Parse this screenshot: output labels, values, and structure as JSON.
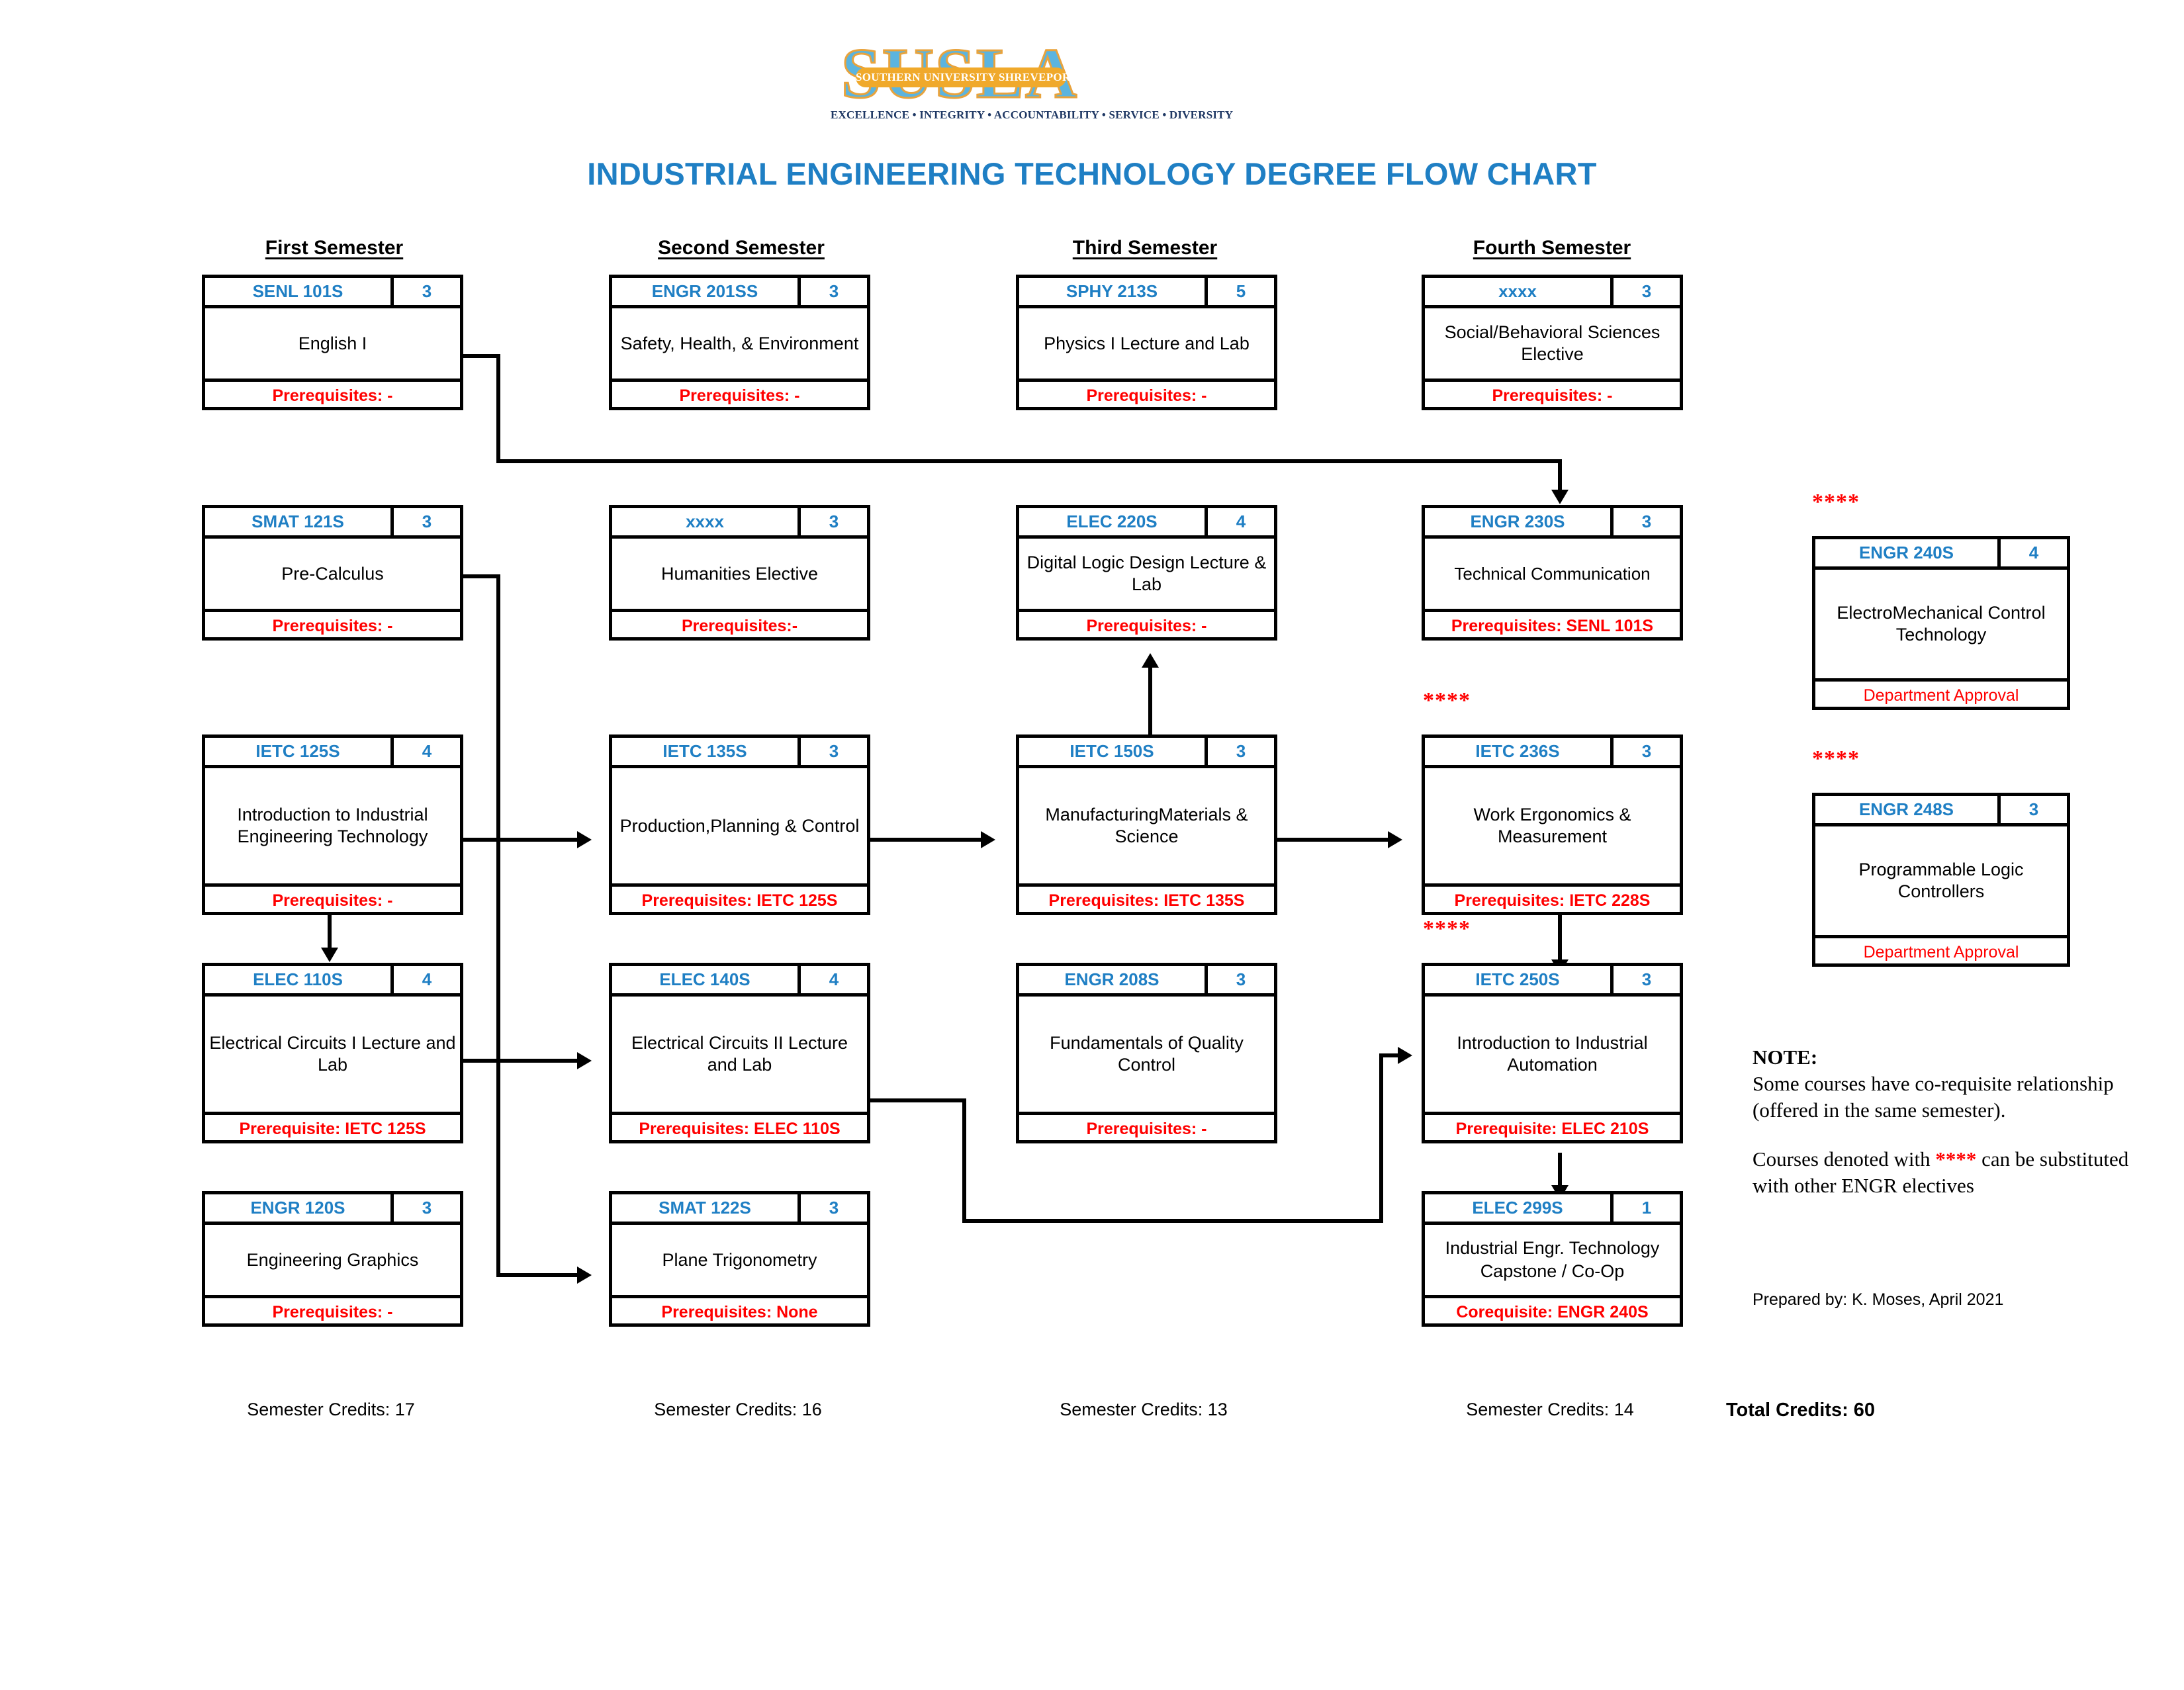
{
  "logo": {
    "word": "SUSLA",
    "band": "SOUTHERN UNIVERSITY SHREVEPORT LOUISIANA",
    "tagline": "EXCELLENCE  •  INTEGRITY  •  ACCOUNTABILITY  •  SERVICE  •  DIVERSITY"
  },
  "title": "INDUSTRIAL ENGINEERING TECHNOLOGY DEGREE FLOW CHART",
  "colors": {
    "title_blue": "#1F7FC4",
    "code_blue": "#1F7FC4",
    "prereq_red": "#FF0000",
    "logo_blue": "#5BB4DF",
    "logo_gold": "#F0A92B"
  },
  "semesters": [
    {
      "header": "First Semester",
      "credits_label": "Semester Credits: 17"
    },
    {
      "header": "Second Semester",
      "credits_label": "Semester Credits: 16"
    },
    {
      "header": "Third Semester",
      "credits_label": "Semester Credits: 13"
    },
    {
      "header": "Fourth Semester",
      "credits_label": "Semester Credits: 14"
    }
  ],
  "total_credits_label": "Total Credits: 60",
  "courses": {
    "senl101s": {
      "code": "SENL 101S",
      "credits": "3",
      "title": "English I",
      "prereq": "Prerequisites: -"
    },
    "smat121s": {
      "code": "SMAT 121S",
      "credits": "3",
      "title": "Pre-Calculus",
      "prereq": "Prerequisites: -"
    },
    "ietc125s": {
      "code": "IETC 125S",
      "credits": "4",
      "title": "Introduction to Industrial Engineering Technology",
      "prereq": "Prerequisites: -"
    },
    "elec110s": {
      "code": "ELEC 110S",
      "credits": "4",
      "title": "Electrical Circuits I Lecture and Lab",
      "prereq": "Prerequisite: IETC 125S"
    },
    "engr120s": {
      "code": "ENGR 120S",
      "credits": "3",
      "title": "Engineering Graphics",
      "prereq": "Prerequisites: -"
    },
    "engr201ss": {
      "code": "ENGR 201SS",
      "credits": "3",
      "title": "Safety, Health, & Environment",
      "prereq": "Prerequisites: -"
    },
    "hum": {
      "code": "xxxx",
      "credits": "3",
      "title": "Humanities Elective",
      "prereq": "Prerequisites:-"
    },
    "ietc135s": {
      "code": "IETC 135S",
      "credits": "3",
      "title": "Production,Planning & Control",
      "prereq": "Prerequisites: IETC 125S"
    },
    "elec140s": {
      "code": "ELEC 140S",
      "credits": "4",
      "title": "Electrical Circuits II Lecture and Lab",
      "prereq": "Prerequisites: ELEC 110S"
    },
    "smat122s": {
      "code": "SMAT 122S",
      "credits": "3",
      "title": "Plane Trigonometry",
      "prereq": "Prerequisites: None"
    },
    "sphy213s": {
      "code": "SPHY 213S",
      "credits": "5",
      "title": "Physics I Lecture and Lab",
      "prereq": "Prerequisites: -"
    },
    "elec220s": {
      "code": "ELEC 220S",
      "credits": "4",
      "title": "Digital Logic Design Lecture & Lab",
      "prereq": "Prerequisites: -"
    },
    "ietc150s": {
      "code": "IETC 150S",
      "credits": "3",
      "title": "ManufacturingMaterials & Science",
      "prereq": "Prerequisites: IETC 135S"
    },
    "engr208s": {
      "code": "ENGR 208S",
      "credits": "3",
      "title": "Fundamentals of Quality Control",
      "prereq": "Prerequisites: -"
    },
    "soc": {
      "code": "xxxx",
      "credits": "3",
      "title": "Social/Behavioral Sciences Elective",
      "prereq": "Prerequisites: -"
    },
    "engr230s": {
      "code": "ENGR 230S",
      "credits": "3",
      "title": "Technical Communication",
      "prereq": "Prerequisites: SENL 101S"
    },
    "ietc236s": {
      "code": "IETC 236S",
      "credits": "3",
      "title": "Work Ergonomics & Measurement",
      "prereq": "Prerequisites: IETC 228S"
    },
    "ietc250s": {
      "code": "IETC 250S",
      "credits": "3",
      "title": "Introduction to Industrial Automation",
      "prereq": "Prerequisite: ELEC 210S"
    },
    "elec299s": {
      "code": "ELEC 299S",
      "credits": "1",
      "title": "Industrial Engr. Technology Capstone / Co-Op",
      "prereq": "Corequisite: ENGR 240S"
    },
    "engr240s": {
      "code": "ENGR 240S",
      "credits": "4",
      "title": "ElectroMechanical Control Technology",
      "prereq": "Department Approval"
    },
    "engr248s": {
      "code": "ENGR 248S",
      "credits": "3",
      "title": "Programmable Logic Controllers",
      "prereq": "Department Approval"
    }
  },
  "star_mark": "****",
  "note": {
    "title": "NOTE:",
    "paragraph1": "Some courses have co-requisite relationship (offered in the same semester).",
    "paragraph2_before": "Courses denoted with ",
    "paragraph2_stars": "****",
    "paragraph2_after": " can be substituted with other ENGR electives",
    "prepared": "Prepared by: K. Moses, April 2021"
  }
}
